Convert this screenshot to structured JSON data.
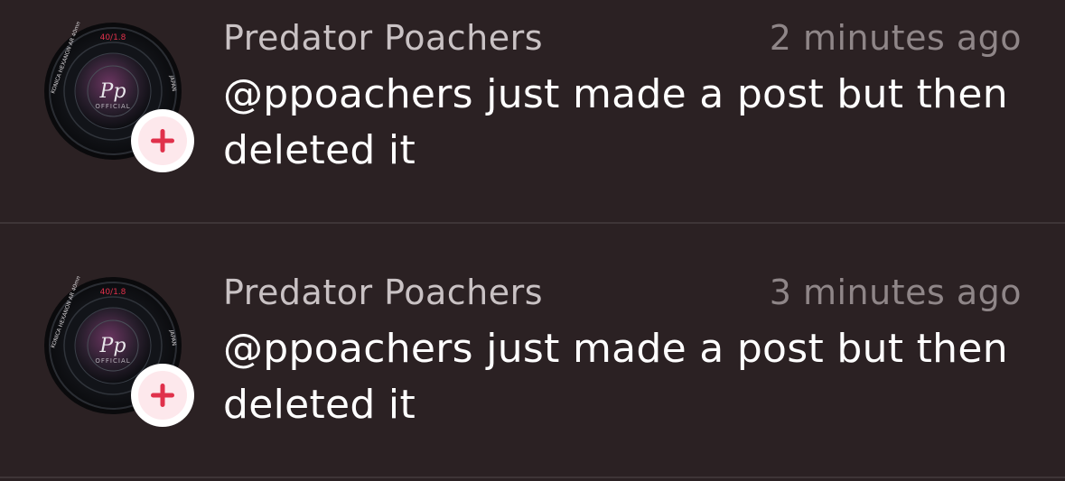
{
  "notifications": [
    {
      "sender": "Predator Poachers",
      "time": "2 minutes ago",
      "message": "@ppoachers just made a post but then deleted it",
      "avatar_text": {
        "top": "40/1.8",
        "monogram": "Pp",
        "sub": "OFFICIAL",
        "ring_left": "KONICA HEXANON AR 40mm F1.8",
        "ring_right": "JAPAN"
      },
      "badge_icon": "plus-icon"
    },
    {
      "sender": "Predator Poachers",
      "time": "3 minutes ago",
      "message": "@ppoachers just made a post but then deleted it",
      "avatar_text": {
        "top": "40/1.8",
        "monogram": "Pp",
        "sub": "OFFICIAL",
        "ring_left": "KONICA HEXANON AR 40mm F1.8",
        "ring_right": "JAPAN"
      },
      "badge_icon": "plus-icon"
    }
  ],
  "colors": {
    "background": "#2b2123",
    "divider": "#3e3537",
    "sender": "#c9c2c4",
    "time": "#8f8688",
    "message": "#ffffff",
    "badge_plus": "#e0314b"
  }
}
